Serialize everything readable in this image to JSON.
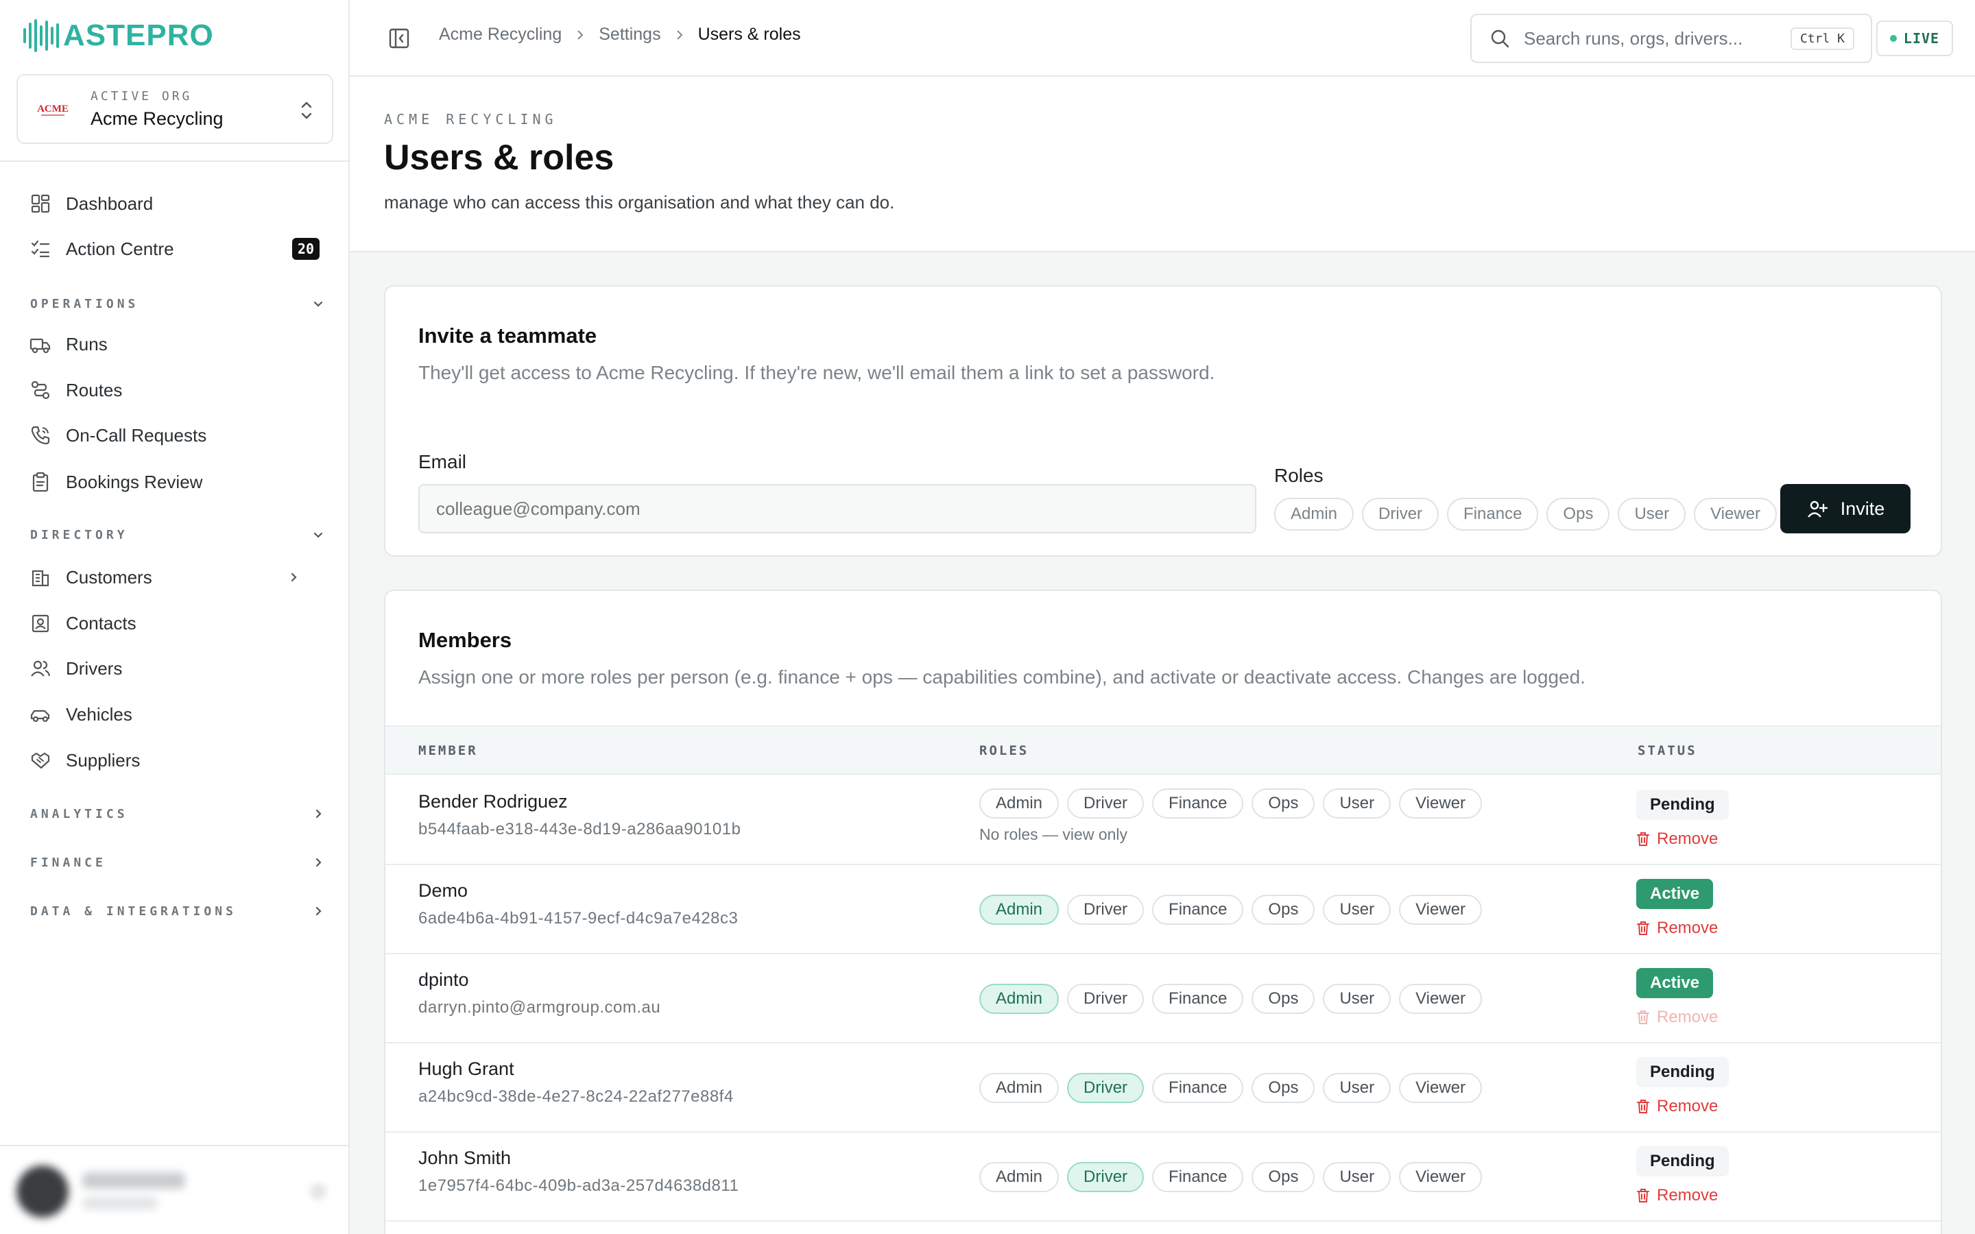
{
  "brand": {
    "name": "ASTEPRO",
    "color": "#2fb3a0"
  },
  "org": {
    "label": "ACTIVE ORG",
    "name": "Acme Recycling",
    "logo_text": "ACME"
  },
  "nav": {
    "dashboard": "Dashboard",
    "action_centre": "Action Centre",
    "action_centre_badge": "20",
    "operations": "OPERATIONS",
    "runs": "Runs",
    "routes": "Routes",
    "oncall": "On-Call Requests",
    "bookings": "Bookings Review",
    "directory": "DIRECTORY",
    "customers": "Customers",
    "contacts": "Contacts",
    "drivers": "Drivers",
    "vehicles": "Vehicles",
    "suppliers": "Suppliers",
    "analytics": "ANALYTICS",
    "finance": "FINANCE",
    "data_integrations": "DATA & INTEGRATIONS"
  },
  "topbar": {
    "breadcrumbs": [
      "Acme Recycling",
      "Settings",
      "Users & roles"
    ],
    "search_placeholder": "Search runs, orgs, drivers...",
    "search_shortcut": "Ctrl K",
    "live_label": "LIVE"
  },
  "page": {
    "eyebrow": "ACME RECYCLING",
    "title": "Users & roles",
    "subtitle": "manage who can access this organisation and what they can do."
  },
  "invite": {
    "title": "Invite a teammate",
    "subtitle": "They'll get access to Acme Recycling. If they're new, we'll email them a link to set a password.",
    "email_label": "Email",
    "email_placeholder": "colleague@company.com",
    "roles_label": "Roles",
    "roles": [
      "Admin",
      "Driver",
      "Finance",
      "Ops",
      "User",
      "Viewer"
    ],
    "button": "Invite"
  },
  "members": {
    "title": "Members",
    "subtitle": "Assign one or more roles per person (e.g. finance + ops — capabilities combine), and activate or deactivate access. Changes are logged.",
    "col_member": "MEMBER",
    "col_roles": "ROLES",
    "col_status": "STATUS",
    "remove_label": "Remove",
    "no_roles_text": "No roles — view only",
    "role_names": [
      "Admin",
      "Driver",
      "Finance",
      "Ops",
      "User",
      "Viewer"
    ],
    "rows": [
      {
        "name": "Bender Rodriguez",
        "id": "b544faab-e318-443e-8d19-a286aa90101b",
        "active_roles": [],
        "status": "Pending",
        "remove_disabled": false
      },
      {
        "name": "Demo",
        "id": "6ade4b6a-4b91-4157-9ecf-d4c9a7e428c3",
        "active_roles": [
          "Admin"
        ],
        "status": "Active",
        "remove_disabled": false
      },
      {
        "name": "dpinto",
        "id": "darryn.pinto@armgroup.com.au",
        "active_roles": [
          "Admin"
        ],
        "status": "Active",
        "remove_disabled": true
      },
      {
        "name": "Hugh Grant",
        "id": "a24bc9cd-38de-4e27-8c24-22af277e88f4",
        "active_roles": [
          "Driver"
        ],
        "status": "Pending",
        "remove_disabled": false
      },
      {
        "name": "John Smith",
        "id": "1e7957f4-64bc-409b-ad3a-257d4638d811",
        "active_roles": [
          "Driver"
        ],
        "status": "Pending",
        "remove_disabled": false
      }
    ]
  }
}
